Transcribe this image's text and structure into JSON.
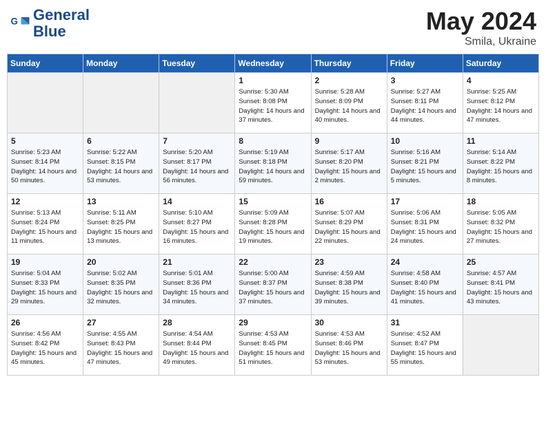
{
  "header": {
    "logo_line1": "General",
    "logo_line2": "Blue",
    "month_year": "May 2024",
    "location": "Smila, Ukraine"
  },
  "weekdays": [
    "Sunday",
    "Monday",
    "Tuesday",
    "Wednesday",
    "Thursday",
    "Friday",
    "Saturday"
  ],
  "weeks": [
    [
      {
        "day": "",
        "empty": true
      },
      {
        "day": "",
        "empty": true
      },
      {
        "day": "",
        "empty": true
      },
      {
        "day": "1",
        "sunrise": "5:30 AM",
        "sunset": "8:08 PM",
        "daylight": "14 hours and 37 minutes."
      },
      {
        "day": "2",
        "sunrise": "5:28 AM",
        "sunset": "8:09 PM",
        "daylight": "14 hours and 40 minutes."
      },
      {
        "day": "3",
        "sunrise": "5:27 AM",
        "sunset": "8:11 PM",
        "daylight": "14 hours and 44 minutes."
      },
      {
        "day": "4",
        "sunrise": "5:25 AM",
        "sunset": "8:12 PM",
        "daylight": "14 hours and 47 minutes."
      }
    ],
    [
      {
        "day": "5",
        "sunrise": "5:23 AM",
        "sunset": "8:14 PM",
        "daylight": "14 hours and 50 minutes."
      },
      {
        "day": "6",
        "sunrise": "5:22 AM",
        "sunset": "8:15 PM",
        "daylight": "14 hours and 53 minutes."
      },
      {
        "day": "7",
        "sunrise": "5:20 AM",
        "sunset": "8:17 PM",
        "daylight": "14 hours and 56 minutes."
      },
      {
        "day": "8",
        "sunrise": "5:19 AM",
        "sunset": "8:18 PM",
        "daylight": "14 hours and 59 minutes."
      },
      {
        "day": "9",
        "sunrise": "5:17 AM",
        "sunset": "8:20 PM",
        "daylight": "15 hours and 2 minutes."
      },
      {
        "day": "10",
        "sunrise": "5:16 AM",
        "sunset": "8:21 PM",
        "daylight": "15 hours and 5 minutes."
      },
      {
        "day": "11",
        "sunrise": "5:14 AM",
        "sunset": "8:22 PM",
        "daylight": "15 hours and 8 minutes."
      }
    ],
    [
      {
        "day": "12",
        "sunrise": "5:13 AM",
        "sunset": "8:24 PM",
        "daylight": "15 hours and 11 minutes."
      },
      {
        "day": "13",
        "sunrise": "5:11 AM",
        "sunset": "8:25 PM",
        "daylight": "15 hours and 13 minutes."
      },
      {
        "day": "14",
        "sunrise": "5:10 AM",
        "sunset": "8:27 PM",
        "daylight": "15 hours and 16 minutes."
      },
      {
        "day": "15",
        "sunrise": "5:09 AM",
        "sunset": "8:28 PM",
        "daylight": "15 hours and 19 minutes."
      },
      {
        "day": "16",
        "sunrise": "5:07 AM",
        "sunset": "8:29 PM",
        "daylight": "15 hours and 22 minutes."
      },
      {
        "day": "17",
        "sunrise": "5:06 AM",
        "sunset": "8:31 PM",
        "daylight": "15 hours and 24 minutes."
      },
      {
        "day": "18",
        "sunrise": "5:05 AM",
        "sunset": "8:32 PM",
        "daylight": "15 hours and 27 minutes."
      }
    ],
    [
      {
        "day": "19",
        "sunrise": "5:04 AM",
        "sunset": "8:33 PM",
        "daylight": "15 hours and 29 minutes."
      },
      {
        "day": "20",
        "sunrise": "5:02 AM",
        "sunset": "8:35 PM",
        "daylight": "15 hours and 32 minutes."
      },
      {
        "day": "21",
        "sunrise": "5:01 AM",
        "sunset": "8:36 PM",
        "daylight": "15 hours and 34 minutes."
      },
      {
        "day": "22",
        "sunrise": "5:00 AM",
        "sunset": "8:37 PM",
        "daylight": "15 hours and 37 minutes."
      },
      {
        "day": "23",
        "sunrise": "4:59 AM",
        "sunset": "8:38 PM",
        "daylight": "15 hours and 39 minutes."
      },
      {
        "day": "24",
        "sunrise": "4:58 AM",
        "sunset": "8:40 PM",
        "daylight": "15 hours and 41 minutes."
      },
      {
        "day": "25",
        "sunrise": "4:57 AM",
        "sunset": "8:41 PM",
        "daylight": "15 hours and 43 minutes."
      }
    ],
    [
      {
        "day": "26",
        "sunrise": "4:56 AM",
        "sunset": "8:42 PM",
        "daylight": "15 hours and 45 minutes."
      },
      {
        "day": "27",
        "sunrise": "4:55 AM",
        "sunset": "8:43 PM",
        "daylight": "15 hours and 47 minutes."
      },
      {
        "day": "28",
        "sunrise": "4:54 AM",
        "sunset": "8:44 PM",
        "daylight": "15 hours and 49 minutes."
      },
      {
        "day": "29",
        "sunrise": "4:53 AM",
        "sunset": "8:45 PM",
        "daylight": "15 hours and 51 minutes."
      },
      {
        "day": "30",
        "sunrise": "4:53 AM",
        "sunset": "8:46 PM",
        "daylight": "15 hours and 53 minutes."
      },
      {
        "day": "31",
        "sunrise": "4:52 AM",
        "sunset": "8:47 PM",
        "daylight": "15 hours and 55 minutes."
      },
      {
        "day": "",
        "empty": true
      }
    ]
  ],
  "labels": {
    "sunrise_prefix": "Sunrise: ",
    "sunset_prefix": "Sunset: ",
    "daylight_prefix": "Daylight: "
  }
}
